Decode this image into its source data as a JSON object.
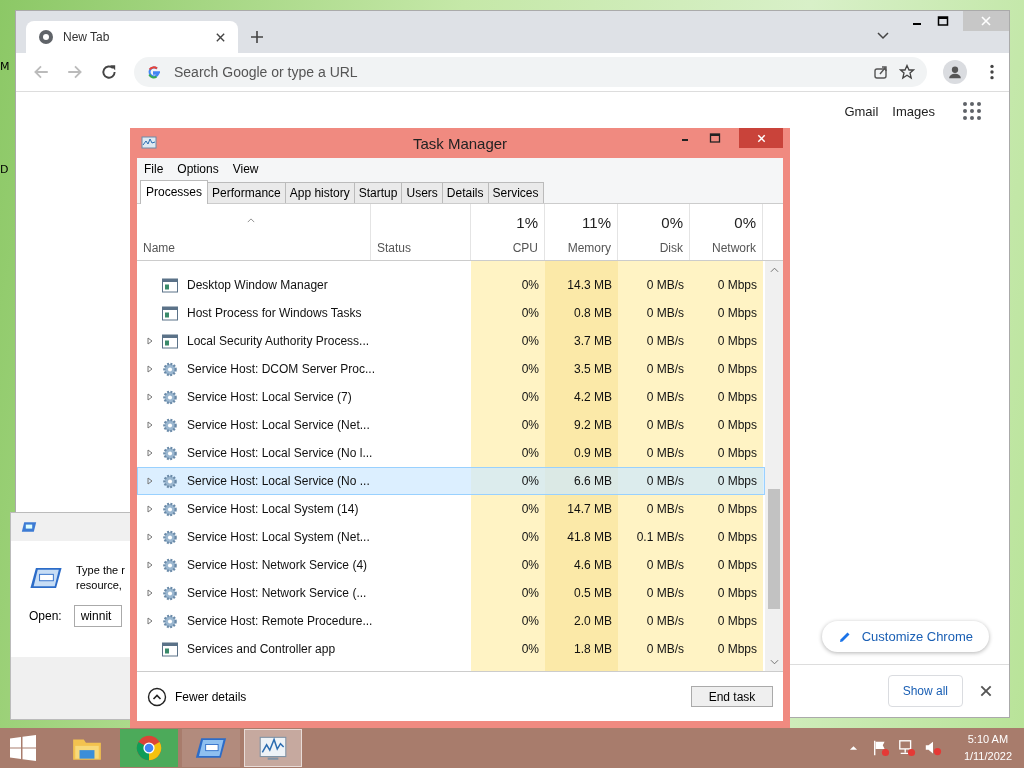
{
  "desktop": {
    "labels": [
      "M",
      "D"
    ]
  },
  "browser": {
    "tab": {
      "title": "New Tab"
    },
    "omnibox": {
      "placeholder": "Search Google or type a URL"
    },
    "links": [
      "Gmail",
      "Images"
    ],
    "customize_button": "Customize Chrome",
    "download_bar": {
      "button": "Show all"
    }
  },
  "run_dialog": {
    "prompt_lines": [
      "Type the r",
      "resource,"
    ],
    "open_label": "Open:",
    "value": "winnit"
  },
  "task_manager": {
    "title": "Task Manager",
    "menu": [
      "File",
      "Options",
      "View"
    ],
    "tabs": [
      {
        "label": "Processes",
        "selected": true
      },
      {
        "label": "Performance",
        "selected": false
      },
      {
        "label": "App history",
        "selected": false
      },
      {
        "label": "Startup",
        "selected": false
      },
      {
        "label": "Users",
        "selected": false
      },
      {
        "label": "Details",
        "selected": false
      },
      {
        "label": "Services",
        "selected": false
      }
    ],
    "columns": [
      {
        "label": "Name"
      },
      {
        "label": "Status"
      },
      {
        "summary": "1%",
        "label": "CPU"
      },
      {
        "summary": "11%",
        "label": "Memory"
      },
      {
        "summary": "0%",
        "label": "Disk"
      },
      {
        "summary": "0%",
        "label": "Network"
      }
    ],
    "rows": [
      {
        "name": "Desktop Window Manager",
        "kind": "app",
        "expandable": false,
        "selected": false,
        "cpu": "0%",
        "memory": "14.3 MB",
        "disk": "0 MB/s",
        "network": "0 Mbps"
      },
      {
        "name": "Host Process for Windows Tasks",
        "kind": "app",
        "expandable": false,
        "selected": false,
        "cpu": "0%",
        "memory": "0.8 MB",
        "disk": "0 MB/s",
        "network": "0 Mbps"
      },
      {
        "name": "Local Security Authority Process...",
        "kind": "app",
        "expandable": true,
        "selected": false,
        "cpu": "0%",
        "memory": "3.7 MB",
        "disk": "0 MB/s",
        "network": "0 Mbps"
      },
      {
        "name": "Service Host: DCOM Server Proc...",
        "kind": "service",
        "expandable": true,
        "selected": false,
        "cpu": "0%",
        "memory": "3.5 MB",
        "disk": "0 MB/s",
        "network": "0 Mbps"
      },
      {
        "name": "Service Host: Local Service (7)",
        "kind": "service",
        "expandable": true,
        "selected": false,
        "cpu": "0%",
        "memory": "4.2 MB",
        "disk": "0 MB/s",
        "network": "0 Mbps"
      },
      {
        "name": "Service Host: Local Service (Net...",
        "kind": "service",
        "expandable": true,
        "selected": false,
        "cpu": "0%",
        "memory": "9.2 MB",
        "disk": "0 MB/s",
        "network": "0 Mbps"
      },
      {
        "name": "Service Host: Local Service (No l...",
        "kind": "service",
        "expandable": true,
        "selected": false,
        "cpu": "0%",
        "memory": "0.9 MB",
        "disk": "0 MB/s",
        "network": "0 Mbps"
      },
      {
        "name": "Service Host: Local Service (No ...",
        "kind": "service",
        "expandable": true,
        "selected": true,
        "cpu": "0%",
        "memory": "6.6 MB",
        "disk": "0 MB/s",
        "network": "0 Mbps"
      },
      {
        "name": "Service Host: Local System (14)",
        "kind": "service",
        "expandable": true,
        "selected": false,
        "cpu": "0%",
        "memory": "14.7 MB",
        "disk": "0 MB/s",
        "network": "0 Mbps"
      },
      {
        "name": "Service Host: Local System (Net...",
        "kind": "service",
        "expandable": true,
        "selected": false,
        "cpu": "0%",
        "memory": "41.8 MB",
        "disk": "0.1 MB/s",
        "network": "0 Mbps"
      },
      {
        "name": "Service Host: Network Service (4)",
        "kind": "service",
        "expandable": true,
        "selected": false,
        "cpu": "0%",
        "memory": "4.6 MB",
        "disk": "0 MB/s",
        "network": "0 Mbps"
      },
      {
        "name": "Service Host: Network Service (...",
        "kind": "service",
        "expandable": true,
        "selected": false,
        "cpu": "0%",
        "memory": "0.5 MB",
        "disk": "0 MB/s",
        "network": "0 Mbps"
      },
      {
        "name": "Service Host: Remote Procedure...",
        "kind": "service",
        "expandable": true,
        "selected": false,
        "cpu": "0%",
        "memory": "2.0 MB",
        "disk": "0 MB/s",
        "network": "0 Mbps"
      },
      {
        "name": "Services and Controller app",
        "kind": "app",
        "expandable": false,
        "selected": false,
        "cpu": "0%",
        "memory": "1.8 MB",
        "disk": "0 MB/s",
        "network": "0 Mbps"
      }
    ],
    "footer": {
      "toggle": "Fewer details",
      "button": "End task"
    }
  },
  "taskbar": {
    "apps": [
      {
        "kind": "explorer",
        "focused": false
      },
      {
        "kind": "chrome",
        "focused": false
      },
      {
        "kind": "run",
        "focused": false
      },
      {
        "kind": "taskmgr",
        "focused": true
      }
    ],
    "clock": {
      "time": "5:10 AM",
      "date": "1/11/2022"
    }
  }
}
